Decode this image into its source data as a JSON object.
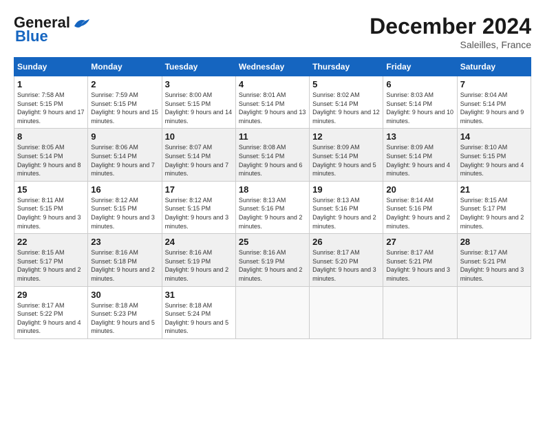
{
  "header": {
    "logo_line1": "General",
    "logo_line2": "Blue",
    "month_title": "December 2024",
    "location": "Saleilles, France"
  },
  "weekdays": [
    "Sunday",
    "Monday",
    "Tuesday",
    "Wednesday",
    "Thursday",
    "Friday",
    "Saturday"
  ],
  "weeks": [
    [
      {
        "day": "1",
        "sunrise": "Sunrise: 7:58 AM",
        "sunset": "Sunset: 5:15 PM",
        "daylight": "Daylight: 9 hours and 17 minutes."
      },
      {
        "day": "2",
        "sunrise": "Sunrise: 7:59 AM",
        "sunset": "Sunset: 5:15 PM",
        "daylight": "Daylight: 9 hours and 15 minutes."
      },
      {
        "day": "3",
        "sunrise": "Sunrise: 8:00 AM",
        "sunset": "Sunset: 5:15 PM",
        "daylight": "Daylight: 9 hours and 14 minutes."
      },
      {
        "day": "4",
        "sunrise": "Sunrise: 8:01 AM",
        "sunset": "Sunset: 5:14 PM",
        "daylight": "Daylight: 9 hours and 13 minutes."
      },
      {
        "day": "5",
        "sunrise": "Sunrise: 8:02 AM",
        "sunset": "Sunset: 5:14 PM",
        "daylight": "Daylight: 9 hours and 12 minutes."
      },
      {
        "day": "6",
        "sunrise": "Sunrise: 8:03 AM",
        "sunset": "Sunset: 5:14 PM",
        "daylight": "Daylight: 9 hours and 10 minutes."
      },
      {
        "day": "7",
        "sunrise": "Sunrise: 8:04 AM",
        "sunset": "Sunset: 5:14 PM",
        "daylight": "Daylight: 9 hours and 9 minutes."
      }
    ],
    [
      {
        "day": "8",
        "sunrise": "Sunrise: 8:05 AM",
        "sunset": "Sunset: 5:14 PM",
        "daylight": "Daylight: 9 hours and 8 minutes."
      },
      {
        "day": "9",
        "sunrise": "Sunrise: 8:06 AM",
        "sunset": "Sunset: 5:14 PM",
        "daylight": "Daylight: 9 hours and 7 minutes."
      },
      {
        "day": "10",
        "sunrise": "Sunrise: 8:07 AM",
        "sunset": "Sunset: 5:14 PM",
        "daylight": "Daylight: 9 hours and 7 minutes."
      },
      {
        "day": "11",
        "sunrise": "Sunrise: 8:08 AM",
        "sunset": "Sunset: 5:14 PM",
        "daylight": "Daylight: 9 hours and 6 minutes."
      },
      {
        "day": "12",
        "sunrise": "Sunrise: 8:09 AM",
        "sunset": "Sunset: 5:14 PM",
        "daylight": "Daylight: 9 hours and 5 minutes."
      },
      {
        "day": "13",
        "sunrise": "Sunrise: 8:09 AM",
        "sunset": "Sunset: 5:14 PM",
        "daylight": "Daylight: 9 hours and 4 minutes."
      },
      {
        "day": "14",
        "sunrise": "Sunrise: 8:10 AM",
        "sunset": "Sunset: 5:15 PM",
        "daylight": "Daylight: 9 hours and 4 minutes."
      }
    ],
    [
      {
        "day": "15",
        "sunrise": "Sunrise: 8:11 AM",
        "sunset": "Sunset: 5:15 PM",
        "daylight": "Daylight: 9 hours and 3 minutes."
      },
      {
        "day": "16",
        "sunrise": "Sunrise: 8:12 AM",
        "sunset": "Sunset: 5:15 PM",
        "daylight": "Daylight: 9 hours and 3 minutes."
      },
      {
        "day": "17",
        "sunrise": "Sunrise: 8:12 AM",
        "sunset": "Sunset: 5:15 PM",
        "daylight": "Daylight: 9 hours and 3 minutes."
      },
      {
        "day": "18",
        "sunrise": "Sunrise: 8:13 AM",
        "sunset": "Sunset: 5:16 PM",
        "daylight": "Daylight: 9 hours and 2 minutes."
      },
      {
        "day": "19",
        "sunrise": "Sunrise: 8:13 AM",
        "sunset": "Sunset: 5:16 PM",
        "daylight": "Daylight: 9 hours and 2 minutes."
      },
      {
        "day": "20",
        "sunrise": "Sunrise: 8:14 AM",
        "sunset": "Sunset: 5:16 PM",
        "daylight": "Daylight: 9 hours and 2 minutes."
      },
      {
        "day": "21",
        "sunrise": "Sunrise: 8:15 AM",
        "sunset": "Sunset: 5:17 PM",
        "daylight": "Daylight: 9 hours and 2 minutes."
      }
    ],
    [
      {
        "day": "22",
        "sunrise": "Sunrise: 8:15 AM",
        "sunset": "Sunset: 5:17 PM",
        "daylight": "Daylight: 9 hours and 2 minutes."
      },
      {
        "day": "23",
        "sunrise": "Sunrise: 8:16 AM",
        "sunset": "Sunset: 5:18 PM",
        "daylight": "Daylight: 9 hours and 2 minutes."
      },
      {
        "day": "24",
        "sunrise": "Sunrise: 8:16 AM",
        "sunset": "Sunset: 5:19 PM",
        "daylight": "Daylight: 9 hours and 2 minutes."
      },
      {
        "day": "25",
        "sunrise": "Sunrise: 8:16 AM",
        "sunset": "Sunset: 5:19 PM",
        "daylight": "Daylight: 9 hours and 2 minutes."
      },
      {
        "day": "26",
        "sunrise": "Sunrise: 8:17 AM",
        "sunset": "Sunset: 5:20 PM",
        "daylight": "Daylight: 9 hours and 3 minutes."
      },
      {
        "day": "27",
        "sunrise": "Sunrise: 8:17 AM",
        "sunset": "Sunset: 5:21 PM",
        "daylight": "Daylight: 9 hours and 3 minutes."
      },
      {
        "day": "28",
        "sunrise": "Sunrise: 8:17 AM",
        "sunset": "Sunset: 5:21 PM",
        "daylight": "Daylight: 9 hours and 3 minutes."
      }
    ],
    [
      {
        "day": "29",
        "sunrise": "Sunrise: 8:17 AM",
        "sunset": "Sunset: 5:22 PM",
        "daylight": "Daylight: 9 hours and 4 minutes."
      },
      {
        "day": "30",
        "sunrise": "Sunrise: 8:18 AM",
        "sunset": "Sunset: 5:23 PM",
        "daylight": "Daylight: 9 hours and 5 minutes."
      },
      {
        "day": "31",
        "sunrise": "Sunrise: 8:18 AM",
        "sunset": "Sunset: 5:24 PM",
        "daylight": "Daylight: 9 hours and 5 minutes."
      },
      null,
      null,
      null,
      null
    ]
  ]
}
